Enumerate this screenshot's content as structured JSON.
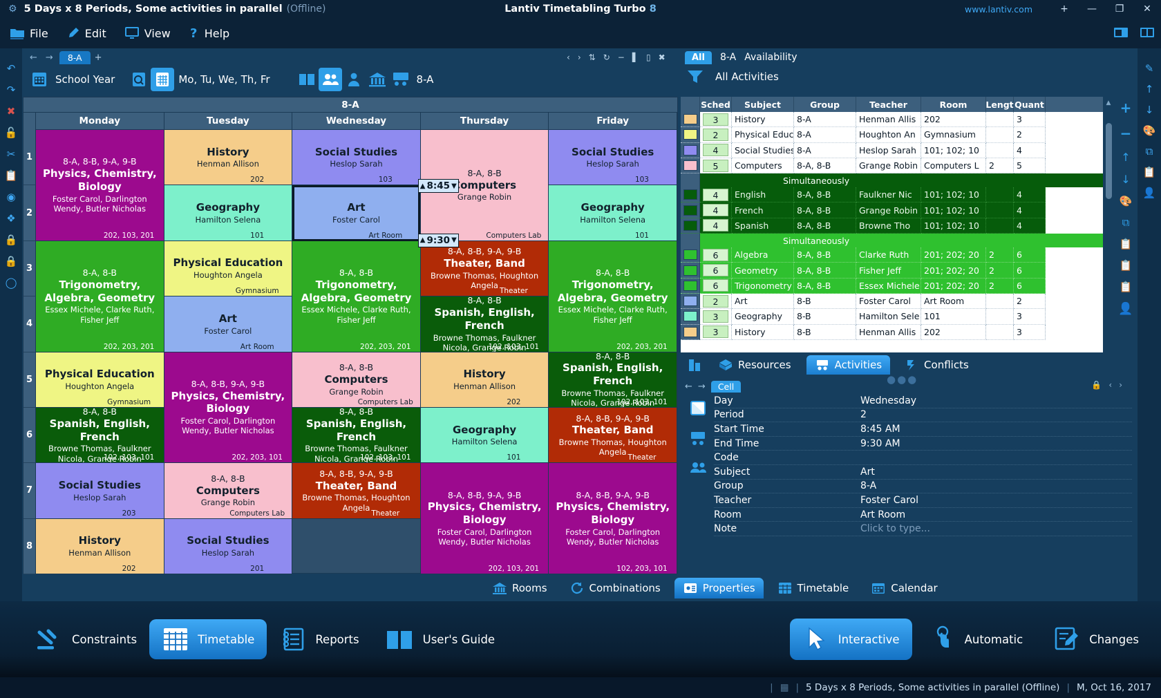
{
  "titlebar": {
    "gear_icon": "gear-icon",
    "document_title": "5 Days x 8 Periods, Some activities in parallel",
    "offline": "(Offline)",
    "app_name": "Lantiv Timetabling Turbo",
    "app_version": "8",
    "url": "www.lantiv.com",
    "btn_new": "+",
    "btn_minimize": "—",
    "btn_maximize": "❐",
    "btn_close": "✕"
  },
  "menubar": {
    "items": [
      {
        "label": "File",
        "icon": "folder-icon"
      },
      {
        "label": "Edit",
        "icon": "pen-icon"
      },
      {
        "label": "View",
        "icon": "monitor-icon"
      },
      {
        "label": "Help",
        "icon": "question-icon"
      }
    ],
    "right_icons": [
      "window-icon",
      "panels-icon"
    ]
  },
  "tabstrip": {
    "back_arrow": "←",
    "forward_arrow": "→",
    "tab_label": "8-A",
    "add_tab": "+"
  },
  "toolbar2": {
    "school_year": "School Year",
    "days": "Mo, Tu, We, Th, Fr",
    "selection": "8-A",
    "icons": [
      "undo-icon",
      "calendar-grid-icon",
      "search-calendar-icon",
      "calendar-icon",
      "book-icon",
      "groups-icon",
      "teacher-icon",
      "building-icon",
      "classroom-icon"
    ]
  },
  "top_window_tools": [
    "prev-icon",
    "next-icon",
    "swap-icon",
    "refresh-icon",
    "minimize-icon",
    "split-icon",
    "restore-icon",
    "close-icon"
  ],
  "timetable": {
    "title": "8-A",
    "days": [
      "Monday",
      "Tuesday",
      "Wednesday",
      "Thursday",
      "Friday"
    ],
    "periods": [
      "1",
      "2",
      "3",
      "4",
      "5",
      "6",
      "7",
      "8"
    ],
    "selected_cell": {
      "day": "Wednesday",
      "period": "2",
      "start": "8:45",
      "end": "9:30"
    },
    "cells": {
      "monday": [
        {
          "span": 2,
          "groups": "8-A, 8-B, 9-A, 9-B",
          "subject": "Physics, Chemistry, Biology",
          "teacher": "Foster Carol, Darlington Wendy, Butler Nicholas",
          "room": "202, 103, 201",
          "bg": "#9c0a8e",
          "fg": "light-text"
        },
        {
          "span": 2,
          "groups": "8-A, 8-B",
          "subject": "Trigonometry, Algebra, Geometry",
          "teacher": "Essex Michele, Clarke Ruth, Fisher Jeff",
          "room": "202, 203, 201",
          "bg": "#2fac24",
          "fg": "light-text"
        },
        {
          "span": 1,
          "groups": "",
          "subject": "Physical Education",
          "teacher": "Houghton Angela",
          "room": "Gymnasium",
          "bg": "#eff584",
          "fg": "dark-text"
        },
        {
          "span": 1,
          "groups": "8-A, 8-B",
          "subject": "Spanish, English, French",
          "teacher": "Browne Thomas, Faulkner Nicola, Grange Robin",
          "room": "102, 103, 101",
          "bg": "#0a5c0a",
          "fg": "light-text"
        },
        {
          "span": 1,
          "groups": "",
          "subject": "Social Studies",
          "teacher": "Heslop Sarah",
          "room": "203",
          "bg": "#8f8bf0",
          "fg": "dark-text"
        },
        {
          "span": 1,
          "groups": "",
          "subject": "History",
          "teacher": "Henman Allison",
          "room": "202",
          "bg": "#f5cd8a",
          "fg": "dark-text"
        }
      ],
      "tuesday": [
        {
          "span": 1,
          "groups": "",
          "subject": "History",
          "teacher": "Henman Allison",
          "room": "202",
          "bg": "#f5cd8a",
          "fg": "dark-text"
        },
        {
          "span": 1,
          "groups": "",
          "subject": "Geography",
          "teacher": "Hamilton Selena",
          "room": "101",
          "bg": "#7df0cb",
          "fg": "dark-text"
        },
        {
          "span": 1,
          "groups": "",
          "subject": "Physical Education",
          "teacher": "Houghton Angela",
          "room": "Gymnasium",
          "bg": "#eff584",
          "fg": "dark-text"
        },
        {
          "span": 1,
          "groups": "",
          "subject": "Art",
          "teacher": "Foster Carol",
          "room": "Art Room",
          "bg": "#8fafef",
          "fg": "dark-text"
        },
        {
          "span": 2,
          "groups": "8-A, 8-B, 9-A, 9-B",
          "subject": "Physics, Chemistry, Biology",
          "teacher": "Foster Carol, Darlington Wendy, Butler Nicholas",
          "room": "202, 203, 101",
          "bg": "#9c0a8e",
          "fg": "light-text"
        },
        {
          "span": 1,
          "groups": "8-A, 8-B",
          "subject": "Computers",
          "teacher": "Grange Robin",
          "room": "Computers Lab",
          "bg": "#f8bfcd",
          "fg": "dark-text"
        },
        {
          "span": 1,
          "groups": "",
          "subject": "Social Studies",
          "teacher": "Heslop Sarah",
          "room": "201",
          "bg": "#8f8bf0",
          "fg": "dark-text"
        }
      ],
      "wednesday": [
        {
          "span": 1,
          "groups": "",
          "subject": "Social Studies",
          "teacher": "Heslop Sarah",
          "room": "103",
          "bg": "#8f8bf0",
          "fg": "dark-text"
        },
        {
          "span": 1,
          "groups": "",
          "subject": "Art",
          "teacher": "Foster Carol",
          "room": "Art Room",
          "bg": "#8fafef",
          "fg": "dark-text",
          "selected": true
        },
        {
          "span": 2,
          "groups": "8-A, 8-B",
          "subject": "Trigonometry, Algebra, Geometry",
          "teacher": "Essex Michele, Clarke Ruth, Fisher Jeff",
          "room": "202, 203, 201",
          "bg": "#2fac24",
          "fg": "light-text"
        },
        {
          "span": 1,
          "groups": "8-A, 8-B",
          "subject": "Computers",
          "teacher": "Grange Robin",
          "room": "Computers Lab",
          "bg": "#f8bfcd",
          "fg": "dark-text"
        },
        {
          "span": 1,
          "groups": "8-A, 8-B",
          "subject": "Spanish, English, French",
          "teacher": "Browne Thomas, Faulkner Nicola, Grange Robin",
          "room": "102, 103, 101",
          "bg": "#0a5c0a",
          "fg": "light-text"
        },
        {
          "span": 1,
          "groups": "8-A, 8-B, 9-A, 9-B",
          "subject": "Theater, Band",
          "teacher": "Browne Thomas, Houghton Angela",
          "room": "Theater",
          "bg": "#b12b06",
          "fg": "light-text"
        }
      ],
      "thursday": [
        {
          "span": 2,
          "groups": "8-A, 8-B",
          "subject": "Computers",
          "teacher": "Grange Robin",
          "room": "Computers Lab",
          "bg": "#f8bfcd",
          "fg": "dark-text"
        },
        {
          "span": 1,
          "groups": "8-A, 8-B, 9-A, 9-B",
          "subject": "Theater, Band",
          "teacher": "Browne Thomas, Houghton Angela",
          "room": "Theater",
          "bg": "#b12b06",
          "fg": "light-text"
        },
        {
          "span": 1,
          "groups": "8-A, 8-B",
          "subject": "Spanish, English, French",
          "teacher": "Browne Thomas, Faulkner Nicola, Grange Robin",
          "room": "102, 103, 101",
          "bg": "#0a5c0a",
          "fg": "light-text"
        },
        {
          "span": 1,
          "groups": "",
          "subject": "History",
          "teacher": "Henman Allison",
          "room": "202",
          "bg": "#f5cd8a",
          "fg": "dark-text"
        },
        {
          "span": 1,
          "groups": "",
          "subject": "Geography",
          "teacher": "Hamilton Selena",
          "room": "101",
          "bg": "#7df0cb",
          "fg": "dark-text"
        },
        {
          "span": 2,
          "groups": "8-A, 8-B, 9-A, 9-B",
          "subject": "Physics, Chemistry, Biology",
          "teacher": "Foster Carol, Darlington Wendy, Butler Nicholas",
          "room": "202, 103, 201",
          "bg": "#9c0a8e",
          "fg": "light-text"
        }
      ],
      "friday": [
        {
          "span": 1,
          "groups": "",
          "subject": "Social Studies",
          "teacher": "Heslop Sarah",
          "room": "103",
          "bg": "#8f8bf0",
          "fg": "dark-text"
        },
        {
          "span": 1,
          "groups": "",
          "subject": "Geography",
          "teacher": "Hamilton Selena",
          "room": "101",
          "bg": "#7df0cb",
          "fg": "dark-text"
        },
        {
          "span": 2,
          "groups": "8-A, 8-B",
          "subject": "Trigonometry, Algebra, Geometry",
          "teacher": "Essex Michele, Clarke Ruth, Fisher Jeff",
          "room": "202, 203, 201",
          "bg": "#2fac24",
          "fg": "light-text"
        },
        {
          "span": 1,
          "groups": "8-A, 8-B",
          "subject": "Spanish, English, French",
          "teacher": "Browne Thomas, Faulkner Nicola, Grange Robin",
          "room": "102, 103, 101",
          "bg": "#0a5c0a",
          "fg": "light-text"
        },
        {
          "span": 1,
          "groups": "8-A, 8-B, 9-A, 9-B",
          "subject": "Theater, Band",
          "teacher": "Browne Thomas, Houghton Angela",
          "room": "Theater",
          "bg": "#b12b06",
          "fg": "light-text"
        },
        {
          "span": 2,
          "groups": "8-A, 8-B, 9-A, 9-B",
          "subject": "Physics, Chemistry, Biology",
          "teacher": "Foster Carol, Darlington Wendy, Butler Nicholas",
          "room": "102, 203, 101",
          "bg": "#9c0a8e",
          "fg": "light-text"
        }
      ]
    }
  },
  "right_panel": {
    "all_button": "All",
    "group_label": "8-A",
    "availability": "Availability",
    "filter_label": "All Activities",
    "columns": [
      "Sched",
      "Subject",
      "Group",
      "Teacher",
      "Room",
      "Lengt",
      "Quant"
    ],
    "rows": [
      {
        "swatch": "#f5cd8a",
        "sched": "3",
        "subject": "History",
        "group": "8-A",
        "teacher": "Henman Allis",
        "room": "202",
        "length": "",
        "quantity": "3",
        "style": "plain"
      },
      {
        "swatch": "#eff584",
        "sched": "2",
        "subject": "Physical Educ",
        "group": "8-A",
        "teacher": "Houghton An",
        "room": "Gymnasium",
        "length": "",
        "quantity": "2",
        "style": "plain"
      },
      {
        "swatch": "#8f8bf0",
        "sched": "4",
        "subject": "Social Studies",
        "group": "8-A",
        "teacher": "Heslop Sarah",
        "room": "101; 102; 10",
        "length": "",
        "quantity": "4",
        "style": "plain"
      },
      {
        "swatch": "#f8bfcd",
        "sched": "5",
        "subject": "Computers",
        "group": "8-A, 8-B",
        "teacher": "Grange Robin",
        "room": "Computers L",
        "length": "2",
        "quantity": "5",
        "style": "plain"
      },
      {
        "group_header": "Simultaneously",
        "style": "dark-header"
      },
      {
        "swatch": "#065c0b",
        "sched": "4",
        "subject": "English",
        "group": "8-A, 8-B",
        "teacher": "Faulkner Nic",
        "room": "101; 102; 10",
        "length": "",
        "quantity": "4",
        "style": "dark"
      },
      {
        "swatch": "#065c0b",
        "sched": "4",
        "subject": "French",
        "group": "8-A, 8-B",
        "teacher": "Grange Robin",
        "room": "101; 102; 10",
        "length": "",
        "quantity": "4",
        "style": "dark"
      },
      {
        "swatch": "#065c0b",
        "sched": "4",
        "subject": "Spanish",
        "group": "8-A, 8-B",
        "teacher": "Browne Tho",
        "room": "101; 102; 10",
        "length": "",
        "quantity": "4",
        "style": "dark"
      },
      {
        "group_header": "Simultaneously",
        "style": "green-header"
      },
      {
        "swatch": "#2fc12f",
        "sched": "6",
        "subject": "Algebra",
        "group": "8-A, 8-B",
        "teacher": "Clarke Ruth",
        "room": "201; 202; 20",
        "length": "2",
        "quantity": "6",
        "style": "green"
      },
      {
        "swatch": "#2fc12f",
        "sched": "6",
        "subject": "Geometry",
        "group": "8-A, 8-B",
        "teacher": "Fisher Jeff",
        "room": "201; 202; 20",
        "length": "2",
        "quantity": "6",
        "style": "green"
      },
      {
        "swatch": "#2fc12f",
        "sched": "6",
        "subject": "Trigonometry",
        "group": "8-A, 8-B",
        "teacher": "Essex Michele",
        "room": "201; 202; 20",
        "length": "2",
        "quantity": "6",
        "style": "green"
      },
      {
        "swatch": "#8fafef",
        "sched": "2",
        "subject": "Art",
        "group": "8-B",
        "teacher": "Foster Carol",
        "room": "Art Room",
        "length": "",
        "quantity": "2",
        "style": "plain"
      },
      {
        "swatch": "#7df0cb",
        "sched": "3",
        "subject": "Geography",
        "group": "8-B",
        "teacher": "Hamilton Sele",
        "room": "101",
        "length": "",
        "quantity": "3",
        "style": "plain"
      },
      {
        "swatch": "#f5cd8a",
        "sched": "3",
        "subject": "History",
        "group": "8-B",
        "teacher": "Henman Allis",
        "room": "202",
        "length": "",
        "quantity": "3",
        "style": "plain"
      }
    ],
    "side_tools": [
      "plus-icon",
      "minus-icon",
      "up-arrow-icon",
      "down-arrow-icon",
      "palette-icon",
      "copy-icon",
      "clipboard-icon",
      "paste-icon",
      "paste-add-icon",
      "person-icon"
    ],
    "tabs": [
      {
        "label": "",
        "icon": "building-icon",
        "active": false
      },
      {
        "label": "Resources",
        "icon": "box-icon",
        "active": false
      },
      {
        "label": "Activities",
        "icon": "activities-icon",
        "active": true
      },
      {
        "label": "Conflicts",
        "icon": "conflict-icon",
        "active": false
      }
    ]
  },
  "properties": {
    "chip": "Cell",
    "back_arrow": "←",
    "forward_arrow": "→",
    "rows": [
      {
        "key": "Day",
        "value": "Wednesday"
      },
      {
        "key": "Period",
        "value": "2"
      },
      {
        "key": "Start Time",
        "value": "8:45 AM"
      },
      {
        "key": "End Time",
        "value": "9:30 AM"
      },
      {
        "key": "Code",
        "value": ""
      },
      {
        "key": "Subject",
        "value": "Art"
      },
      {
        "key": "Group",
        "value": "8-A"
      },
      {
        "key": "Teacher",
        "value": "Foster Carol"
      },
      {
        "key": "Room",
        "value": "Art Room"
      },
      {
        "key": "Note",
        "value": "Click to type...",
        "muted": true
      }
    ],
    "icons": [
      "folder-icon",
      "classroom-icon",
      "groups-icon"
    ]
  },
  "mid_tabs": [
    {
      "label": "Rooms",
      "icon": "building-icon",
      "active": false
    },
    {
      "label": "Combinations",
      "icon": "refresh-icon",
      "active": false
    },
    {
      "label": "Properties",
      "icon": "properties-icon",
      "active": true
    },
    {
      "label": "Timetable",
      "icon": "grid-icon",
      "active": false
    },
    {
      "label": "Calendar",
      "icon": "calendar-icon",
      "active": false
    }
  ],
  "bottom_bar": {
    "left_tabs": [
      {
        "label": "Constraints",
        "icon": "gavel-icon",
        "active": false
      },
      {
        "label": "Timetable",
        "icon": "grid-icon",
        "active": true
      },
      {
        "label": "Reports",
        "icon": "report-icon",
        "active": false
      },
      {
        "label": "User's Guide",
        "icon": "book-icon",
        "active": false
      }
    ],
    "right_tabs": [
      {
        "label": "Interactive",
        "icon": "cursor-icon",
        "active": true
      },
      {
        "label": "Automatic",
        "icon": "hand-icon",
        "active": false
      },
      {
        "label": "Changes",
        "icon": "edit-doc-icon",
        "active": false
      }
    ]
  },
  "statusbar": {
    "doc": "5 Days x 8 Periods, Some activities in parallel (Offline)",
    "date": "M, Oct 16, 2017"
  }
}
